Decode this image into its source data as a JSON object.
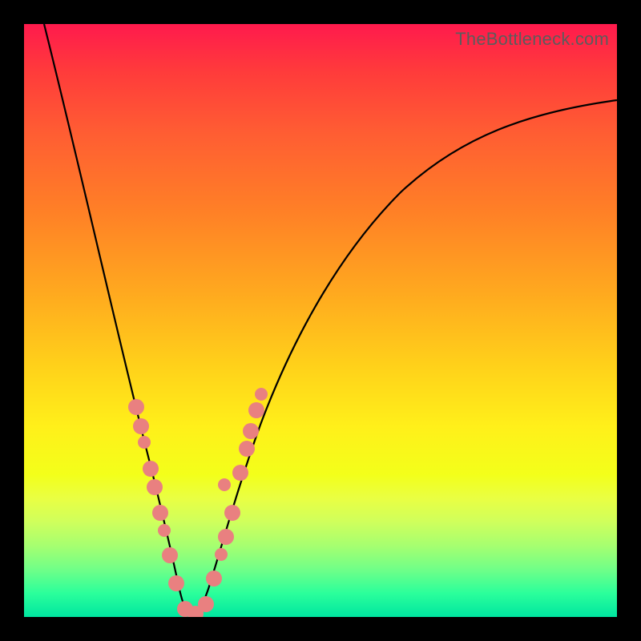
{
  "watermark": "TheBottleneck.com",
  "colors": {
    "background": "#000000",
    "gradient_top": "#ff1a4d",
    "gradient_bottom": "#00e6a0",
    "curve": "#000000",
    "dots": "#e98080"
  },
  "chart_data": {
    "type": "line",
    "title": "",
    "xlabel": "",
    "ylabel": "",
    "xlim": [
      0,
      100
    ],
    "ylim": [
      0,
      100
    ],
    "grid": false,
    "legend": false,
    "note": "V-shaped bottleneck curve; y rises sharply away from minimum near x≈27. Values are estimated from pixels (no axis ticks visible).",
    "series": [
      {
        "name": "curve",
        "x": [
          3,
          6,
          10,
          14,
          18,
          22,
          24,
          26,
          27,
          28,
          30,
          32,
          35,
          40,
          48,
          58,
          70,
          84,
          100
        ],
        "y": [
          100,
          86,
          70,
          54,
          40,
          20,
          10,
          3,
          0,
          2,
          8,
          16,
          28,
          45,
          60,
          70,
          77,
          81,
          84
        ]
      }
    ],
    "scatter_points": {
      "name": "highlighted-points",
      "note": "Salmon dots clustered on both branches near the minimum",
      "x": [
        18,
        19,
        19.5,
        20.5,
        21,
        22,
        22.5,
        23.5,
        24.5,
        26,
        27,
        28.5,
        29.5,
        30.5,
        31,
        31.5,
        32,
        33,
        33.5,
        34
      ],
      "y": [
        40,
        36,
        33,
        29,
        26,
        20,
        17,
        12,
        8,
        2,
        1,
        4,
        7,
        11,
        14,
        18,
        23,
        27,
        32,
        36
      ]
    }
  }
}
